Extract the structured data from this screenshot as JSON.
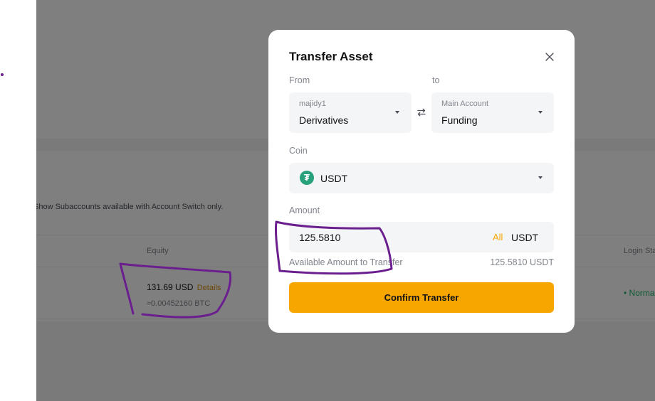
{
  "background": {
    "note": "Show Subaccounts available with Account Switch only.",
    "table": {
      "equity_header": "Equity",
      "login_status_header": "Login Sta",
      "row": {
        "equity_value": "131.69 USD",
        "details_link": "Details",
        "btc_value": "≈0.00452160 BTC",
        "login_status": "• Norma"
      }
    }
  },
  "modal": {
    "title": "Transfer Asset",
    "close_icon": "close-icon",
    "from_label": "From",
    "to_label": "to",
    "from_account": {
      "sub": "majidy1",
      "main": "Derivatives"
    },
    "to_account": {
      "sub": "Main Account",
      "main": "Funding"
    },
    "swap_icon": "swap-arrows-icon",
    "coin_label": "Coin",
    "coin": {
      "symbol": "₮",
      "name": "USDT",
      "icon_color": "#26a17b"
    },
    "amount_label": "Amount",
    "amount_value": "125.5810",
    "all_link": "All",
    "amount_unit": "USDT",
    "available_label": "Available Amount to Transfer",
    "available_value": "125.5810 USDT",
    "confirm_button": "Confirm Transfer"
  },
  "colors": {
    "accent": "#f7a600",
    "input_bg": "#f4f5f7",
    "annotation": "#6b1f8f",
    "success": "#20b26c"
  }
}
